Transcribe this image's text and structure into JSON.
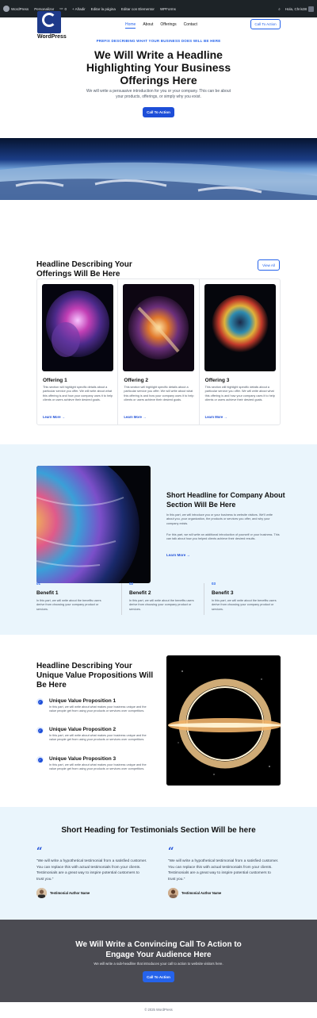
{
  "admin_bar": {
    "items": [
      "WordPress",
      "Personalizar",
      "0",
      "+ Añadir",
      "Editar la página",
      "Editar con Elementor",
      "WPForms"
    ],
    "greeting": "Hola, Chris38"
  },
  "header": {
    "site_name": "WordPress",
    "nav": [
      "Home",
      "About",
      "Offerings",
      "Contact"
    ],
    "cta": "Call To Action"
  },
  "hero": {
    "prefix": "PREFIX DESCRIBING WHAT YOUR BUSINESS DOES WILL BE HERE",
    "title": "We Will Write a Headline Highlighting Your Business Offerings Here",
    "text": "We will write a persuasive introduction for you or your company. This can be about your products, offerings, or simply why you exist.",
    "button": "Call To Action"
  },
  "offerings": {
    "title": "Headline Describing Your Offerings Will Be Here",
    "view_all": "View All",
    "cards": [
      {
        "title": "Offering 1",
        "text": "This section will highlight specific details about a particular service you offer. We will write about what this offering is and how your company uses it to help clients or users achieve their desired goals.",
        "link": "Learn More"
      },
      {
        "title": "Offering 2",
        "text": "This section will highlight specific details about a particular service you offer. We will write about what this offering is and how your company uses it to help clients or users achieve their desired goals.",
        "link": "Learn More"
      },
      {
        "title": "Offering 3",
        "text": "This section will highlight specific details about a particular service you offer. We will write about what this offering is and how your company uses it to help clients or users achieve their desired goals.",
        "link": "Learn More"
      }
    ]
  },
  "about": {
    "title": "Short Headline for Company About Section Will Be Here",
    "p1": "In this part, we will introduce you or your business to website visitors. We'll write about you, your organization, the products or services you offer, and why your company exists.",
    "p2": "For this part, we will write an additional introduction of yourself or your business. This can talk about how you helped clients achieve their desired results.",
    "link": "Learn More",
    "benefits": [
      {
        "num": "01",
        "title": "Benefit 1",
        "text": "In this part, we will write about the benefits users derive from choosing your company product or services."
      },
      {
        "num": "02",
        "title": "Benefit 2",
        "text": "In this part, we will write about the benefits users derive from choosing your company product or services."
      },
      {
        "num": "03",
        "title": "Benefit 3",
        "text": "In this part, we will write about the benefits users derive from choosing your company product or services."
      }
    ]
  },
  "value_props": {
    "title": "Headline Describing Your Unique Value Propositions Will Be Here",
    "items": [
      {
        "title": "Unique Value Proposition 1",
        "text": "In this part, we will write about what makes your business unique and the value people get from using your products or services over competitors."
      },
      {
        "title": "Unique Value Proposition 2",
        "text": "In this part, we will write about what makes your business unique and the value people get from using your products or services over competitors."
      },
      {
        "title": "Unique Value Proposition 3",
        "text": "In this part, we will write about what makes your business unique and the value people get from using your products or services over competitors."
      }
    ]
  },
  "testimonials": {
    "title": "Short Heading for Testimonials Section Will be here",
    "items": [
      {
        "quote": "“We will write a hypothetical testimonial from a satisfied customer. You can replace this with actual testimonials from your clients. Testimonials are a great way to inspire potential customers to trust you.”",
        "author": "Testimonial Author Name"
      },
      {
        "quote": "“We will write a hypothetical testimonial from a satisfied customer. You can replace this with actual testimonials from your clients. Testimonials are a great way to inspire potential customers to trust you.”",
        "author": "Testimonial Author Name"
      }
    ]
  },
  "cta": {
    "title": "We Will Write a Convincing Call To Action to Engage Your Audience Here",
    "sub": "We will write a sub-headline that introduces your call to action to website visitors here.",
    "button": "Call To Action"
  },
  "footer": {
    "text": "© 2025 WordPress"
  },
  "colors": {
    "accent": "#2563eb",
    "light_section": "#eaf5fc",
    "cta_section": "#4b4b52",
    "admin_bar": "#1d2327"
  }
}
